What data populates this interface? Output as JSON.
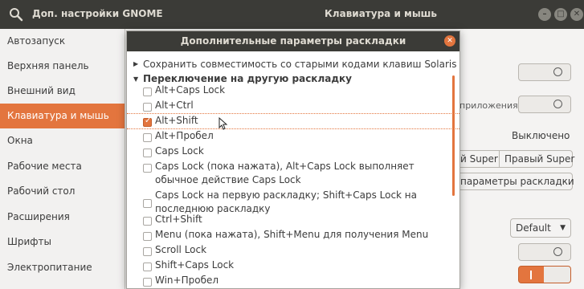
{
  "titlebar": {
    "app_title": "Доп. настройки GNOME",
    "window_title": "Клавиатура и мышь"
  },
  "sidebar": {
    "items": [
      {
        "label": "Автозапуск",
        "active": false
      },
      {
        "label": "Верхняя панель",
        "active": false
      },
      {
        "label": "Внешний вид",
        "active": false
      },
      {
        "label": "Клавиатура и мышь",
        "active": true
      },
      {
        "label": "Окна",
        "active": false
      },
      {
        "label": "Рабочие места",
        "active": false
      },
      {
        "label": "Рабочий стол",
        "active": false
      },
      {
        "label": "Расширения",
        "active": false
      },
      {
        "label": "Шрифты",
        "active": false
      },
      {
        "label": "Электропитание",
        "active": false
      }
    ]
  },
  "background": {
    "partial_label": "приложения",
    "status_value": "Выключено",
    "super_left_label": "й Super",
    "super_right_label": "Правый Super",
    "layout_button_label": "параметры раскладки",
    "dropdown_value": "Default"
  },
  "dialog": {
    "title": "Дополнительные параметры раскладки",
    "sections": [
      {
        "label": "Сохранить совместимость со старыми кодами клавиш Solaris",
        "expanded": false
      },
      {
        "label": "Переключение на другую раскладку",
        "expanded": true
      }
    ],
    "options": [
      {
        "label": "Alt+Caps Lock",
        "checked": false
      },
      {
        "label": "Alt+Ctrl",
        "checked": false
      },
      {
        "label": "Alt+Shift",
        "checked": true
      },
      {
        "label": "Alt+Пробел",
        "checked": false
      },
      {
        "label": "Caps Lock",
        "checked": false
      },
      {
        "label": "Caps Lock (пока нажата), Alt+Caps Lock выполняет обычное действие Caps Lock",
        "checked": false
      },
      {
        "label": "Caps Lock на первую раскладку; Shift+Caps Lock на последнюю раскладку",
        "checked": false
      },
      {
        "label": "Ctrl+Shift",
        "checked": false
      },
      {
        "label": "Menu (пока нажата), Shift+Menu для получения Menu",
        "checked": false
      },
      {
        "label": "Scroll Lock",
        "checked": false
      },
      {
        "label": "Shift+Caps Lock",
        "checked": false
      },
      {
        "label": "Win+Пробел",
        "checked": false
      }
    ]
  },
  "colors": {
    "accent": "#e3753e",
    "titlebar": "#3b3b37"
  },
  "icons": {
    "search": "search-icon",
    "cursor": "mouse-pointer-icon"
  }
}
